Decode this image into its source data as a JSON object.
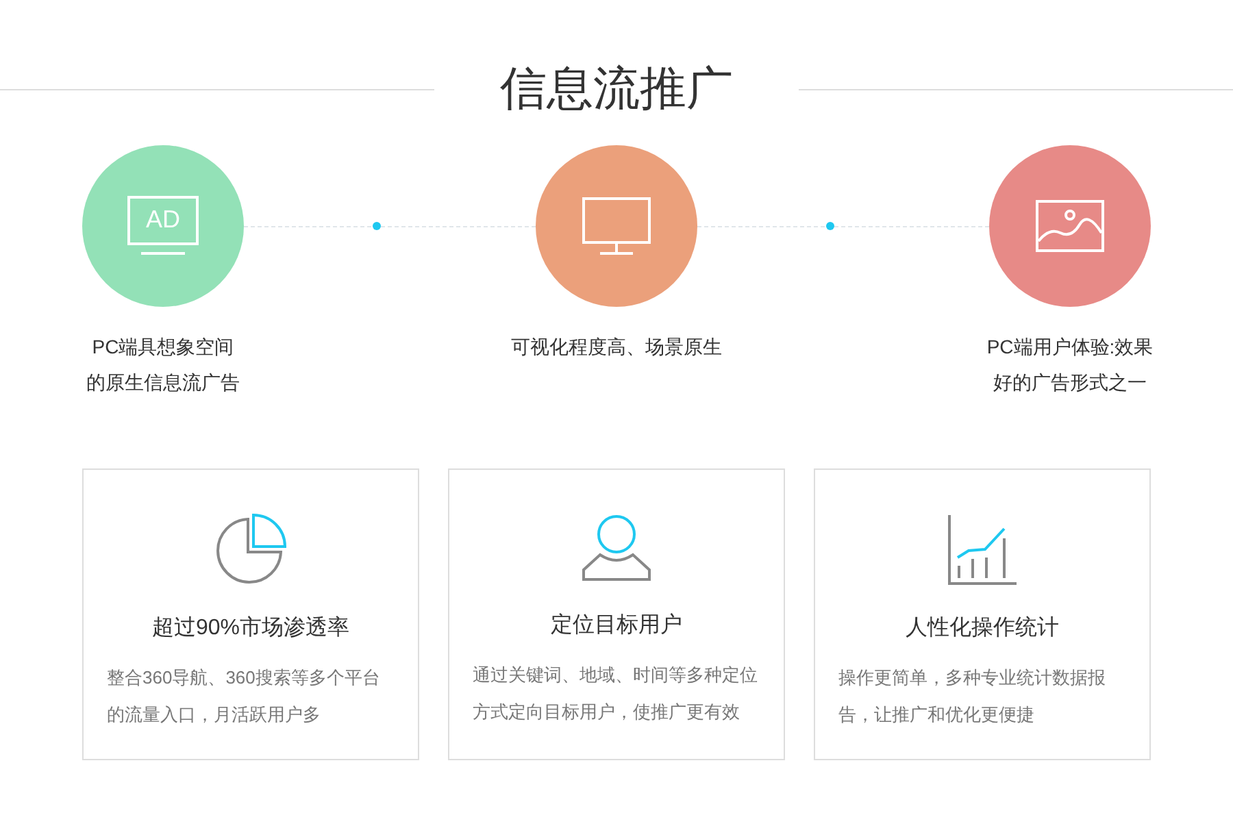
{
  "title": "信息流推广",
  "features": [
    {
      "kind": "ad",
      "color": "#93e1b7",
      "lines": [
        "PC端具想象空间",
        "的原生信息流广告"
      ]
    },
    {
      "kind": "monitor",
      "color": "#eba07b",
      "lines": [
        "可视化程度高、场景原生"
      ]
    },
    {
      "kind": "image",
      "color": "#e78a87",
      "lines": [
        "PC端用户体验:效果",
        "好的广告形式之一"
      ]
    }
  ],
  "ad_label": "AD",
  "cards": [
    {
      "kind": "pie",
      "title": "超过90%市场渗透率",
      "text": "整合360导航、360搜索等多个平台的流量入口，月活跃用户多"
    },
    {
      "kind": "user",
      "title": "定位目标用户",
      "text": "通过关键词、地域、时间等多种定位方式定向目标用户，使推广更有效"
    },
    {
      "kind": "chart",
      "title": "人性化操作统计",
      "text": "操作更简单，多种专业统计数据报告，让推广和优化更便捷"
    }
  ]
}
